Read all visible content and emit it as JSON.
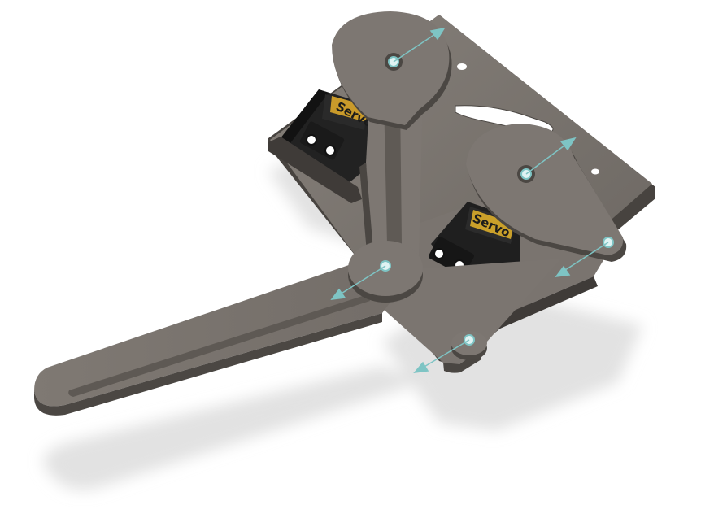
{
  "scene": {
    "servos": [
      {
        "label": "Servo"
      },
      {
        "label": "Servo"
      }
    ],
    "colors": {
      "background": "#ffffff",
      "part_top": "#7b7570",
      "part_side": "#54504c",
      "part_edge": "#3e3a37",
      "servo_body": "#1b1b1b",
      "servo_label_bg": "#d7a224",
      "joint_axis": "#7ec4c4",
      "shadow": "#e3e3e3"
    }
  }
}
